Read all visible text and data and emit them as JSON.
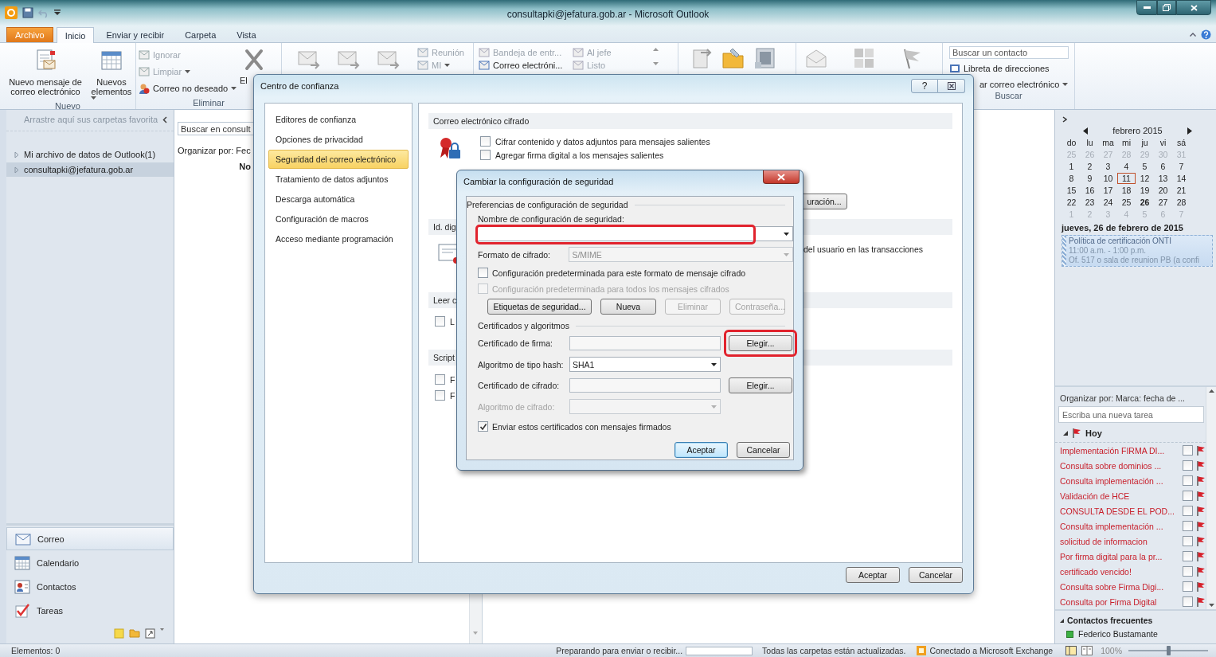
{
  "window": {
    "title": "consultapki@jefatura.gob.ar - Microsoft Outlook"
  },
  "ribbon_tabs": [
    {
      "label": "Archivo",
      "kind": "file",
      "selected": false
    },
    {
      "label": "Inicio",
      "kind": "tab",
      "selected": true
    },
    {
      "label": "Enviar y recibir",
      "kind": "tab",
      "selected": false
    },
    {
      "label": "Carpeta",
      "kind": "tab",
      "selected": false
    },
    {
      "label": "Vista",
      "kind": "tab",
      "selected": false
    }
  ],
  "ribbon": {
    "new_group": {
      "label": "Nuevo",
      "new_email": "Nuevo mensaje de correo electrónico",
      "new_items": "Nuevos elementos"
    },
    "delete_group": {
      "label": "Eliminar",
      "delete_button": "El",
      "items": [
        {
          "label": "Ignorar",
          "disabled": true,
          "menu": false
        },
        {
          "label": "Limpiar",
          "disabled": true,
          "menu": true
        },
        {
          "label": "Correo no deseado",
          "disabled": false,
          "menu": true
        }
      ]
    },
    "respond_group": {
      "items": [
        {
          "label": "Reunión",
          "disabled": true,
          "menu": false
        },
        {
          "label": "MI",
          "disabled": true,
          "menu": true
        }
      ]
    },
    "quick_steps": [
      {
        "label": "Bandeja de entr...",
        "disabled": true
      },
      {
        "label": "Al jefe",
        "disabled": true
      },
      {
        "label": "Correo electróni...",
        "disabled": false
      },
      {
        "label": "Listo",
        "disabled": true
      }
    ],
    "find_group": {
      "label": "Buscar",
      "contact_search_placeholder": "Buscar un contacto",
      "address_book": "Libreta de direcciones",
      "filter_email": "ar correo electrónico"
    }
  },
  "navigation": {
    "favorites_hint": "Arrastre aquí sus carpetas favorita",
    "folders": [
      {
        "label": "Mi archivo de datos de Outlook(1)",
        "selected": false
      },
      {
        "label": "consultapki@jefatura.gob.ar",
        "selected": true
      }
    ],
    "modules": [
      {
        "label": "Correo",
        "kind": "mail",
        "selected": true
      },
      {
        "label": "Calendario",
        "kind": "calendar",
        "selected": false
      },
      {
        "label": "Contactos",
        "kind": "contacts",
        "selected": false
      },
      {
        "label": "Tareas",
        "kind": "tasks",
        "selected": false
      }
    ]
  },
  "mail_list": {
    "search_placeholder": "Buscar en consult",
    "arrange": "Organizar por: Fec",
    "column_1": "No"
  },
  "todo_bar": {
    "calendar": {
      "month": "febrero 2015",
      "weekdays": [
        "do",
        "lu",
        "ma",
        "mi",
        "ju",
        "vi",
        "sá"
      ],
      "weeks": [
        [
          {
            "day": "25",
            "kind": "other"
          },
          {
            "day": "26",
            "kind": "other"
          },
          {
            "day": "27",
            "kind": "other"
          },
          {
            "day": "28",
            "kind": "other"
          },
          {
            "day": "29",
            "kind": "other"
          },
          {
            "day": "30",
            "kind": "other"
          },
          {
            "day": "31",
            "kind": "other"
          }
        ],
        [
          {
            "day": "1",
            "kind": "current"
          },
          {
            "day": "2",
            "kind": "current"
          },
          {
            "day": "3",
            "kind": "current"
          },
          {
            "day": "4",
            "kind": "current"
          },
          {
            "day": "5",
            "kind": "current"
          },
          {
            "day": "6",
            "kind": "current"
          },
          {
            "day": "7",
            "kind": "current"
          }
        ],
        [
          {
            "day": "8",
            "kind": "current"
          },
          {
            "day": "9",
            "kind": "current"
          },
          {
            "day": "10",
            "kind": "current"
          },
          {
            "day": "11",
            "kind": "today"
          },
          {
            "day": "12",
            "kind": "current"
          },
          {
            "day": "13",
            "kind": "current"
          },
          {
            "day": "14",
            "kind": "current"
          }
        ],
        [
          {
            "day": "15",
            "kind": "current"
          },
          {
            "day": "16",
            "kind": "current"
          },
          {
            "day": "17",
            "kind": "current"
          },
          {
            "day": "18",
            "kind": "current"
          },
          {
            "day": "19",
            "kind": "current"
          },
          {
            "day": "20",
            "kind": "current"
          },
          {
            "day": "21",
            "kind": "current"
          }
        ],
        [
          {
            "day": "22",
            "kind": "current"
          },
          {
            "day": "23",
            "kind": "current"
          },
          {
            "day": "24",
            "kind": "current"
          },
          {
            "day": "25",
            "kind": "current"
          },
          {
            "day": "26",
            "kind": "busy"
          },
          {
            "day": "27",
            "kind": "current"
          },
          {
            "day": "28",
            "kind": "current"
          }
        ],
        [
          {
            "day": "1",
            "kind": "other"
          },
          {
            "day": "2",
            "kind": "other"
          },
          {
            "day": "3",
            "kind": "other"
          },
          {
            "day": "4",
            "kind": "other"
          },
          {
            "day": "5",
            "kind": "other"
          },
          {
            "day": "6",
            "kind": "other"
          },
          {
            "day": "7",
            "kind": "other"
          }
        ]
      ]
    },
    "date_heading": "jueves, 26 de febrero de 2015",
    "appointment": {
      "title": "Política de certificación ONTI",
      "time": "11:00 a.m. - 1:00 p.m.",
      "location": "Of. 517 o sala de reunion PB (a confi"
    },
    "tasks": {
      "arrange": "Organizar por: Marca: fecha de ...",
      "new_task_placeholder": "Escriba una nueva tarea",
      "group": "Hoy",
      "items": [
        {
          "title": "Implementación FIRMA DI...",
          "checked": false
        },
        {
          "title": "Consulta sobre dominios ...",
          "checked": false
        },
        {
          "title": "Consulta implementación ...",
          "checked": false
        },
        {
          "title": "Validación de HCE",
          "checked": false
        },
        {
          "title": "CONSULTA DESDE EL POD...",
          "checked": false
        },
        {
          "title": "Consulta implementación ...",
          "checked": false
        },
        {
          "title": "solicitud de informacion",
          "checked": false
        },
        {
          "title": "Por firma digital para la pr...",
          "checked": false
        },
        {
          "title": "certificado vencido!",
          "checked": false
        },
        {
          "title": "Consulta sobre Firma Digi...",
          "checked": false
        },
        {
          "title": "Consulta por Firma Digital",
          "checked": false
        }
      ]
    },
    "contacts": {
      "heading": "Contactos frecuentes",
      "items": [
        {
          "name": "Federico Bustamante"
        }
      ]
    }
  },
  "status_bar": {
    "item_count": "Elementos: 0",
    "sync_status": "Preparando para enviar o recibir...",
    "sync_progress": {
      "level": 0
    },
    "folder_status": "Todas las carpetas están actualizadas.",
    "connection": "Conectado a Microsoft Exchange",
    "zoom": "100%",
    "zoom_slider": {
      "level": 0.5
    }
  },
  "trust_center": {
    "title": "Centro de confianza",
    "help_button": "?",
    "categories": [
      {
        "label": "Editores de confianza",
        "selected": false
      },
      {
        "label": "Opciones de privacidad",
        "selected": false
      },
      {
        "label": "Seguridad del correo electrónico",
        "selected": true
      },
      {
        "label": "Tratamiento de datos adjuntos",
        "selected": false
      },
      {
        "label": "Descarga automática",
        "selected": false
      },
      {
        "label": "Configuración de macros",
        "selected": false
      },
      {
        "label": "Acceso mediante programación",
        "selected": false
      }
    ],
    "encrypted_email": {
      "heading": "Correo electrónico cifrado",
      "options": [
        {
          "label": "Cifrar contenido y datos adjuntos para mensajes salientes",
          "checked": false
        },
        {
          "label": "Agregar firma digital a los mensajes salientes",
          "checked": false
        }
      ],
      "settings_button": "uración..."
    },
    "digital_ids": {
      "heading": "Id. dig",
      "text": "del usuario en las transacciones"
    },
    "read_plain": {
      "heading": "Leer c",
      "options": [
        {
          "label": "L",
          "checked": false
        }
      ]
    },
    "scripts": {
      "heading": "Script",
      "options": [
        {
          "label": "F",
          "checked": false
        },
        {
          "label": "F",
          "checked": false
        }
      ]
    },
    "buttons": [
      "Aceptar",
      "Cancelar"
    ]
  },
  "security_dialog": {
    "title": "Cambiar la configuración de seguridad",
    "preferences": {
      "heading": "Preferencias de configuración de seguridad",
      "name_label": "Nombre de configuración de seguridad:",
      "name_highlighted": true,
      "format_label": "Formato de cifrado:",
      "format_value": "S/MIME",
      "format_disabled": true,
      "defaults": [
        {
          "label": "Configuración predeterminada para este formato de mensaje cifrado",
          "checked": false,
          "disabled": false
        },
        {
          "label": "Configuración predeterminada para todos los mensajes cifrados",
          "checked": false,
          "disabled": true
        }
      ],
      "buttons": [
        {
          "label": "Etiquetas de seguridad...",
          "disabled": false
        },
        {
          "label": "Nueva",
          "disabled": false
        },
        {
          "label": "Eliminar",
          "disabled": true
        },
        {
          "label": "Contraseña...",
          "disabled": true
        }
      ]
    },
    "certificates": {
      "heading": "Certificados y algoritmos",
      "rows": [
        {
          "label": "Certificado de firma:",
          "kind": "field",
          "button": "Elegir...",
          "highlighted": true,
          "disabled": false
        },
        {
          "label": "Algoritmo de tipo hash:",
          "kind": "select",
          "value": "SHA1",
          "disabled": false
        },
        {
          "label": "Certificado de cifrado:",
          "kind": "field",
          "button": "Elegir...",
          "highlighted": false,
          "disabled": false
        },
        {
          "label": "Algoritmo de cifrado:",
          "kind": "select",
          "disabled": true
        }
      ]
    },
    "send_certificates": {
      "label": "Enviar estos certificados con mensajes firmados",
      "checked": true
    },
    "buttons": [
      {
        "label": "Aceptar",
        "default": true
      },
      {
        "label": "Cancelar",
        "default": false
      }
    ]
  }
}
